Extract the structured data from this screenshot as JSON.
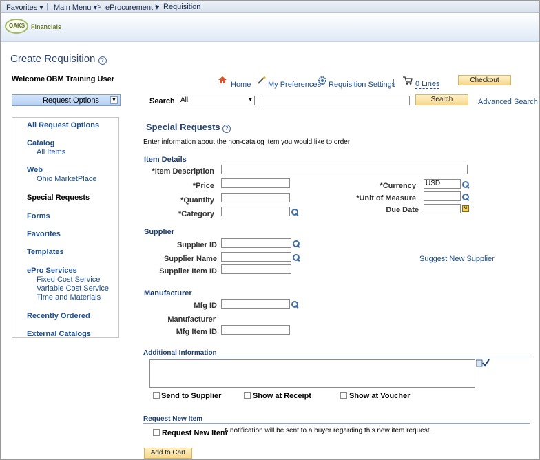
{
  "topnav": {
    "favorites": "Favorites",
    "main_menu": "Main Menu",
    "eprocurement": "eProcurement",
    "requisition": "Requisition",
    "separator": ">"
  },
  "brand": {
    "logo": "OAKS",
    "name": "Financials"
  },
  "page": {
    "title": "Create Requisition"
  },
  "welcome": {
    "label": "Welcome",
    "user": "OBM Training User"
  },
  "toolbar": {
    "home": "Home",
    "preferences": "My Preferences",
    "settings": "Requisition Settings",
    "lines": "0 Lines",
    "checkout": "Checkout",
    "pipe": "|"
  },
  "search_bar": {
    "request_options": "Request Options",
    "search_label": "Search",
    "scope": "All",
    "search_button": "Search",
    "advanced": "Advanced Search"
  },
  "sidebar": {
    "all_request_options": "All Request Options",
    "catalog": "Catalog",
    "all_items": "All Items",
    "web": "Web",
    "ohio_marketplace": "Ohio MarketPlace",
    "special_requests": "Special Requests",
    "forms": "Forms",
    "favorites": "Favorites",
    "templates": "Templates",
    "epro_services": "ePro Services",
    "fixed_cost": "Fixed Cost Service",
    "variable_cost": "Variable Cost Service",
    "time_materials": "Time and Materials",
    "recently_ordered": "Recently Ordered",
    "external_catalogs": "External Catalogs"
  },
  "main": {
    "heading": "Special Requests",
    "intro": "Enter information about the non-catalog item you would like to order:",
    "item_details": "Item Details",
    "item_description": "*Item Description",
    "price": "*Price",
    "currency": "*Currency",
    "currency_value": "USD",
    "quantity": "*Quantity",
    "unit_of_measure": "*Unit of Measure",
    "category": "*Category",
    "due_date": "Due Date",
    "supplier": "Supplier",
    "supplier_id": "Supplier ID",
    "supplier_name": "Supplier Name",
    "supplier_item_id": "Supplier Item ID",
    "suggest_supplier": "Suggest New Supplier",
    "manufacturer_section": "Manufacturer",
    "mfg_id": "Mfg ID",
    "manufacturer": "Manufacturer",
    "mfg_item_id": "Mfg Item ID",
    "additional_info": "Additional Information",
    "send_supplier": "Send to Supplier",
    "show_receipt": "Show at Receipt",
    "show_voucher": "Show at Voucher",
    "request_new_item_section": "Request New Item",
    "request_new_item": "Request New Item",
    "notification": "A notification will be sent to a buyer regarding this new item request.",
    "add_to_cart": "Add to Cart"
  }
}
